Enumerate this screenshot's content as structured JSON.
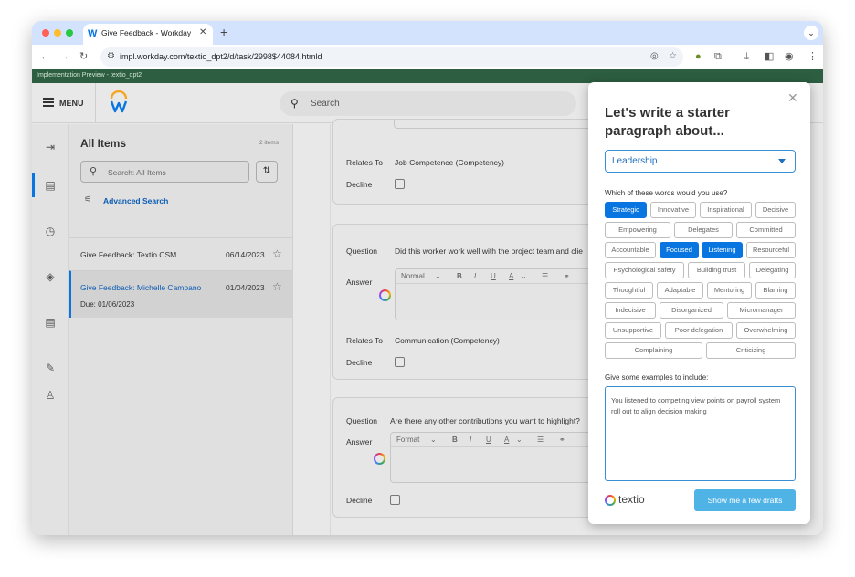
{
  "browser": {
    "tab_title": "Give Feedback - Workday",
    "tab_favicon": "W",
    "url": "impl.workday.com/textio_dpt2/d/task/2998$44084.htmld",
    "colors": {
      "tabstrip": "#d3e3fd",
      "close_light": "#ff5f57",
      "min_light": "#febc2e",
      "max_light": "#28c840"
    }
  },
  "preview_bar": {
    "text": "Implementation Preview - textio_dpt2",
    "color": "#2d5e41"
  },
  "header": {
    "menu_label": "MENU",
    "search_placeholder": "Search"
  },
  "list": {
    "title": "All Items",
    "count": "2 items",
    "search_placeholder": "Search: All Items",
    "advanced_search": "Advanced Search",
    "items": [
      {
        "title": "Give Feedback: Textio CSM",
        "date": "06/14/2023",
        "selected": false
      },
      {
        "title": "Give Feedback: Michelle Campano",
        "date": "01/04/2023",
        "due": "Due: 01/06/2023",
        "selected": true
      }
    ]
  },
  "form": {
    "labels": {
      "relates_to": "Relates To",
      "decline": "Decline",
      "question": "Question",
      "answer": "Answer"
    },
    "card1": {
      "relates_to": "Job Competence (Competency)"
    },
    "card2": {
      "question": "Did this worker work well with the project team and clie",
      "relates_to": "Communication (Competency)",
      "format_label": "Normal"
    },
    "card3": {
      "question": "Are there any other contributions you want to highlight?",
      "format_label": "Format"
    }
  },
  "panel": {
    "title": "Let's write a starter paragraph about...",
    "topic": "Leadership",
    "words_label": "Which of these words would you use?",
    "chips": [
      {
        "label": "Strategic",
        "selected": true
      },
      {
        "label": "Innovative",
        "selected": false
      },
      {
        "label": "Inspirational",
        "selected": false
      },
      {
        "label": "Decisive",
        "selected": false
      },
      {
        "label": "Empowering",
        "selected": false
      },
      {
        "label": "Delegates",
        "selected": false
      },
      {
        "label": "Committed",
        "selected": false
      },
      {
        "label": "Accountable",
        "selected": false
      },
      {
        "label": "Focused",
        "selected": true
      },
      {
        "label": "Listening",
        "selected": true
      },
      {
        "label": "Resourceful",
        "selected": false
      },
      {
        "label": "Psychological safety",
        "selected": false
      },
      {
        "label": "Building trust",
        "selected": false
      },
      {
        "label": "Delegating",
        "selected": false
      },
      {
        "label": "Thoughtful",
        "selected": false
      },
      {
        "label": "Adaptable",
        "selected": false
      },
      {
        "label": "Mentoring",
        "selected": false
      },
      {
        "label": "Blaming",
        "selected": false
      },
      {
        "label": "Indecisive",
        "selected": false
      },
      {
        "label": "Disorganized",
        "selected": false
      },
      {
        "label": "Micromanager",
        "selected": false
      },
      {
        "label": "Unsupportive",
        "selected": false
      },
      {
        "label": "Poor delegation",
        "selected": false
      },
      {
        "label": "Overwhelming",
        "selected": false
      },
      {
        "label": "Complaining",
        "selected": false
      },
      {
        "label": "Criticizing",
        "selected": false
      }
    ],
    "examples_label": "Give some examples to include:",
    "examples_text": "You listened to competing view points on payroll system roll out to align decision making",
    "brand": "textio",
    "cta": "Show me a few drafts",
    "colors": {
      "accent": "#0875e1",
      "cta": "#4fb3e6"
    }
  }
}
